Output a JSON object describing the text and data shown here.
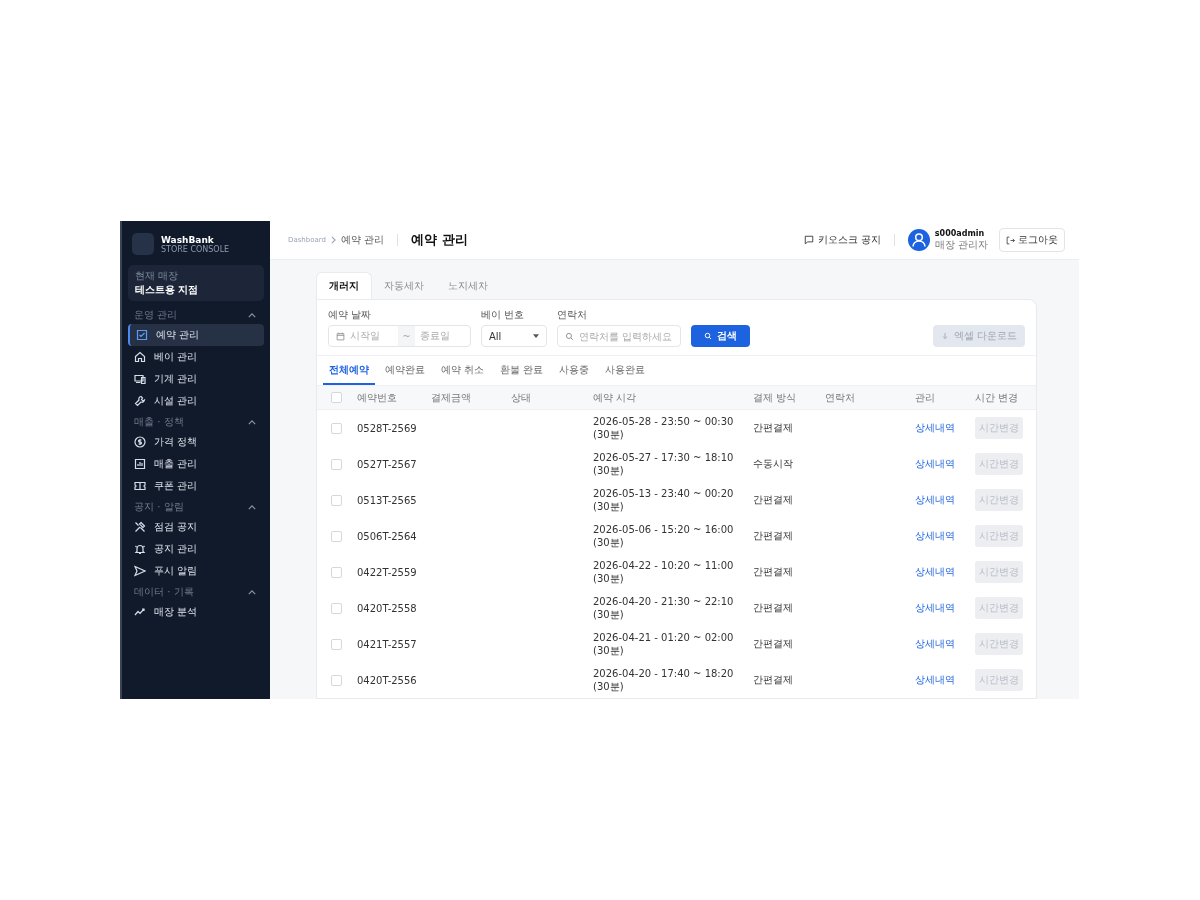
{
  "sidebar": {
    "brand": {
      "name": "WashBank",
      "subtitle": "STORE CONSOLE"
    },
    "store": {
      "label": "현재 매장",
      "name": "테스트용 지점"
    },
    "sections": [
      {
        "title": "운영 관리",
        "expanded": true,
        "items": [
          {
            "label": "예약 관리",
            "selected": true
          },
          {
            "label": "베이 관리",
            "selected": false
          },
          {
            "label": "기계 관리",
            "selected": false
          },
          {
            "label": "시설 관리",
            "selected": false
          }
        ]
      },
      {
        "title": "매출 · 정책",
        "expanded": true,
        "items": [
          {
            "label": "가격 정책",
            "selected": false
          },
          {
            "label": "매출 관리",
            "selected": false
          },
          {
            "label": "쿠폰 관리",
            "selected": false
          }
        ]
      },
      {
        "title": "공지 · 알림",
        "expanded": true,
        "items": [
          {
            "label": "점검 공지",
            "selected": false
          },
          {
            "label": "공지 관리",
            "selected": false
          },
          {
            "label": "푸시 알림",
            "selected": false
          }
        ]
      },
      {
        "title": "데이터 · 기록",
        "expanded": true,
        "items": [
          {
            "label": "매장 분석",
            "selected": false
          }
        ]
      }
    ]
  },
  "header": {
    "breadcrumb": [
      "Dashboard",
      "예약 관리"
    ],
    "title": "예약 관리",
    "kiosk_notice": "키오스크 공지",
    "user": {
      "name": "s000admin",
      "role": "매장 관리자"
    },
    "logout": "로그아웃"
  },
  "tabs": [
    {
      "label": "개러지",
      "selected": true
    },
    {
      "label": "자동세차",
      "selected": false
    },
    {
      "label": "노지세차",
      "selected": false
    }
  ],
  "filters": {
    "date": {
      "label": "예약 날짜",
      "start_placeholder": "시작일",
      "separator": "~",
      "end_placeholder": "종료일"
    },
    "bay": {
      "label": "베이 번호",
      "value": "All"
    },
    "contact": {
      "label": "연락처",
      "placeholder": "연락처를 입력하세요"
    },
    "search_button": "검색",
    "excel_button": {
      "label": "엑셀 다운로드",
      "disabled": true
    }
  },
  "status_tabs": [
    {
      "label": "전체예약",
      "selected": true
    },
    {
      "label": "예약완료",
      "selected": false
    },
    {
      "label": "예약 취소",
      "selected": false
    },
    {
      "label": "환불 완료",
      "selected": false
    },
    {
      "label": "사용중",
      "selected": false
    },
    {
      "label": "사용완료",
      "selected": false
    }
  ],
  "table": {
    "select_all": {
      "checked": false
    },
    "columns": [
      "예약번호",
      "결제금액",
      "상태",
      "예약 시각",
      "결제 방식",
      "연락처",
      "관리",
      "시간 변경"
    ],
    "rows": [
      {
        "checked": false,
        "id": "0528T-2569",
        "time": "2026-05-28 - 23:50 ~ 00:30",
        "duration": "(30분)",
        "payment": "간편결제",
        "detail": "상세내역",
        "change": {
          "label": "시간변경",
          "disabled": true
        }
      },
      {
        "checked": false,
        "id": "0527T-2567",
        "time": "2026-05-27 - 17:30 ~ 18:10",
        "duration": "(30분)",
        "payment": "수동시작",
        "detail": "상세내역",
        "change": {
          "label": "시간변경",
          "disabled": true
        }
      },
      {
        "checked": false,
        "id": "0513T-2565",
        "time": "2026-05-13 - 23:40 ~ 00:20",
        "duration": "(30분)",
        "payment": "간편결제",
        "detail": "상세내역",
        "change": {
          "label": "시간변경",
          "disabled": true
        }
      },
      {
        "checked": false,
        "id": "0506T-2564",
        "time": "2026-05-06 - 15:20 ~ 16:00",
        "duration": "(30분)",
        "payment": "간편결제",
        "detail": "상세내역",
        "change": {
          "label": "시간변경",
          "disabled": true
        }
      },
      {
        "checked": false,
        "id": "0422T-2559",
        "time": "2026-04-22 - 10:20 ~ 11:00",
        "duration": "(30분)",
        "payment": "간편결제",
        "detail": "상세내역",
        "change": {
          "label": "시간변경",
          "disabled": true
        }
      },
      {
        "checked": false,
        "id": "0420T-2558",
        "time": "2026-04-20 - 21:30 ~ 22:10",
        "duration": "(30분)",
        "payment": "간편결제",
        "detail": "상세내역",
        "change": {
          "label": "시간변경",
          "disabled": true
        }
      },
      {
        "checked": false,
        "id": "0421T-2557",
        "time": "2026-04-21 - 01:20 ~ 02:00",
        "duration": "(30분)",
        "payment": "간편결제",
        "detail": "상세내역",
        "change": {
          "label": "시간변경",
          "disabled": true
        }
      },
      {
        "checked": false,
        "id": "0420T-2556",
        "time": "2026-04-20 - 17:40 ~ 18:20",
        "duration": "(30분)",
        "payment": "간편결제",
        "detail": "상세내역",
        "change": {
          "label": "시간변경",
          "disabled": true
        }
      }
    ]
  }
}
